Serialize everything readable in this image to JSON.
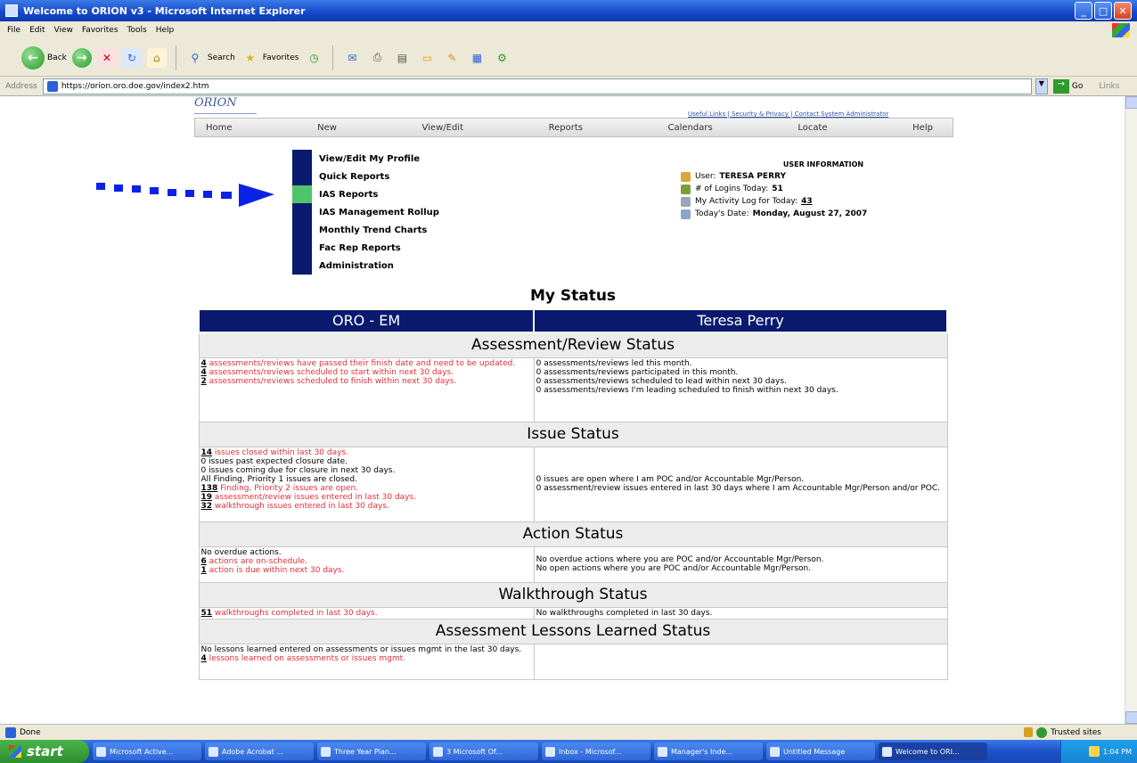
{
  "window": {
    "title": "Welcome to ORION v3 - Microsoft Internet Explorer",
    "min": "_",
    "max": "□",
    "close": "✕"
  },
  "menubar": [
    "File",
    "Edit",
    "View",
    "Favorites",
    "Tools",
    "Help"
  ],
  "toolbar": {
    "back": "Back",
    "search": "Search",
    "favorites": "Favorites"
  },
  "address": {
    "label": "Address",
    "url": "https://orion.oro.doe.gov/index2.htm",
    "go": "Go",
    "links": "Links"
  },
  "page": {
    "logo": "ORION",
    "top_links": "Useful Links | Security & Privacy | Contact System Administrator",
    "nav": [
      "Home",
      "New",
      "View/Edit",
      "Reports",
      "Calendars",
      "Locate",
      "Help"
    ],
    "menu": [
      "View/Edit My Profile",
      "Quick Reports",
      "IAS Reports",
      "IAS Management Rollup",
      "Monthly Trend Charts",
      "Fac Rep Reports",
      "Administration"
    ],
    "user_info": {
      "title": "USER INFORMATION",
      "user_label": "User:",
      "user_value": "TERESA PERRY",
      "logins_label": "# of Logins Today:",
      "logins_value": "51",
      "activity_label": "My Activity Log for Today:",
      "activity_value": "43",
      "date_label": "Today's Date:",
      "date_value": "Monday, August 27, 2007"
    },
    "my_status": "My Status",
    "col_left": "ORO - EM",
    "col_right": "Teresa Perry",
    "sections": {
      "assessment": {
        "title": "Assessment/Review Status",
        "left": [
          {
            "num": "4",
            "text": " assessments/reviews have passed their finish date and need to be updated.",
            "red": true
          },
          {
            "num": "4",
            "text": " assessments/reviews scheduled to start within next 30 days.",
            "red": true
          },
          {
            "num": "2",
            "text": " assessments/reviews scheduled to finish within next 30 days.",
            "red": true
          }
        ],
        "right": [
          "0 assessments/reviews led this month.",
          "0 assessments/reviews participated in this month.",
          "0 assessments/reviews scheduled to lead within next 30 days.",
          "0 assessments/reviews I'm leading scheduled to finish within next 30 days."
        ]
      },
      "issue": {
        "title": "Issue Status",
        "left_1": {
          "num": "14",
          "text": " issues closed within last 30 days."
        },
        "left_plain": [
          "0 issues past expected closure date.",
          "0 issues coming due for closure in next 30 days.",
          "All Finding, Priority 1 issues are closed."
        ],
        "left_2": [
          {
            "num": "138",
            "text": " Finding, Priority 2 issues are open."
          },
          {
            "num": "19",
            "text": " assessment/review issues entered in last 30 days."
          },
          {
            "num": "32",
            "text": " walkthrough issues entered in last 30 days."
          }
        ],
        "right": [
          "0 issues are open where I am POC and/or Accountable Mgr/Person.",
          "0 assessment/review issues entered in last 30 days where I am Accountable Mgr/Person and/or POC."
        ]
      },
      "action": {
        "title": "Action Status",
        "left_plain": "No overdue actions.",
        "left": [
          {
            "num": "6",
            "text": " actions are on-schedule."
          },
          {
            "num": "1",
            "text": " action is due within next 30 days."
          }
        ],
        "right": [
          "No overdue actions where you are POC and/or Accountable Mgr/Person.",
          "No open actions where you are POC and/or Accountable Mgr/Person."
        ]
      },
      "walkthrough": {
        "title": "Walkthrough Status",
        "left": {
          "num": "51",
          "text": " walkthroughs completed in last 30 days."
        },
        "right": "No walkthroughs completed in last 30 days."
      },
      "lessons": {
        "title": "Assessment Lessons Learned Status",
        "left_plain": "No lessons learned entered on assessments or issues mgmt in the last 30 days.",
        "left": {
          "num": "4",
          "text": " lessons learned on assessments or issues mgmt."
        }
      }
    }
  },
  "statusbar": {
    "text": "Done",
    "zone": "Trusted sites"
  },
  "taskbar": {
    "start": "start",
    "tasks": [
      "Microsoft Active...",
      "Adobe Acrobat ...",
      "Three Year Plan...",
      "3 Microsoft Of...",
      "Inbox - Microsof...",
      "Manager's Inde...",
      "Untitled Message",
      "Welcome to ORI..."
    ],
    "clock": "1:04 PM"
  },
  "colors": {
    "navy": "#0a1a6e",
    "active_menu": "#4fc36a",
    "red_text": "#e0303a",
    "arrow_blue": "#0a22e6"
  }
}
